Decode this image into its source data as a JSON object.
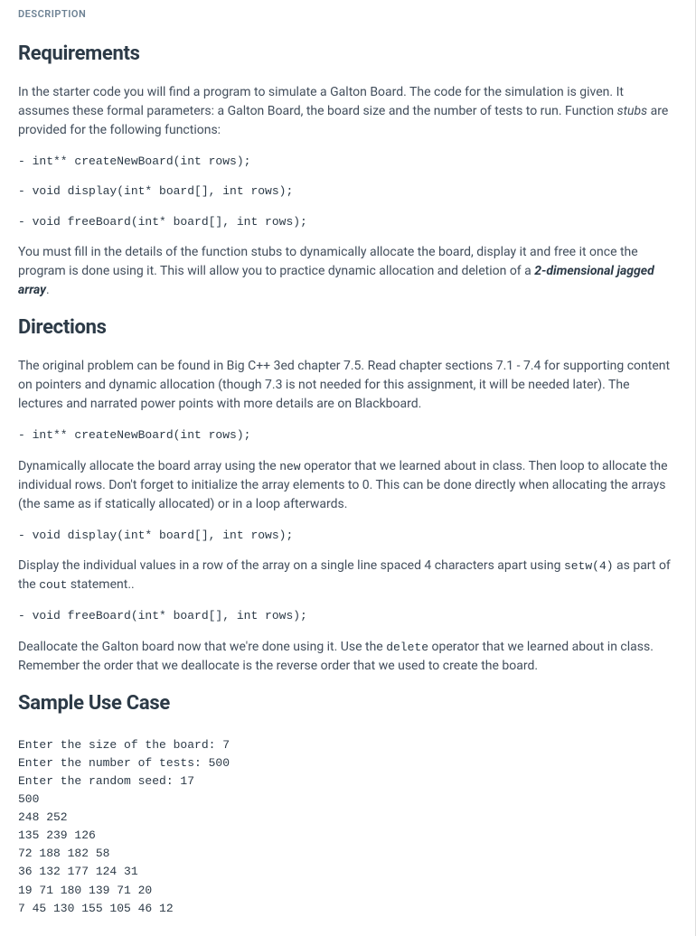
{
  "sectionLabel": "DESCRIPTION",
  "headings": {
    "requirements": "Requirements",
    "directions": "Directions",
    "sample": "Sample Use Case"
  },
  "paragraphs": {
    "req_intro_a": "In the starter code you will find a program to simulate a Galton Board. The code for the simulation is given. It assumes these formal parameters: a Galton Board, the board size and the number of tests to run. Function ",
    "req_intro_stubs": "stubs",
    "req_intro_b": " are provided for the following functions:",
    "req_fill_a": "You must fill in the details of the function stubs to dynamically allocate the board, display it and free it once the program is done using it. This will allow you to practice dynamic allocation and deletion of a ",
    "req_fill_bold": "2-dimensional jagged array",
    "req_fill_b": ".",
    "dir_intro": "The original problem can be found in Big C++ 3ed chapter 7.5. Read chapter sections 7.1 - 7.4 for supporting content on pointers and dynamic allocation (though 7.3 is not needed for this assignment, it will be needed later). The lectures and narrated power points with more details are on Blackboard.",
    "dir_create_a": "Dynamically allocate the board array using the ",
    "dir_create_new": "new",
    "dir_create_b": " operator that we learned about in class. Then loop to allocate the individual rows. Don't forget to initialize the array elements to 0. This can be done directly when allocating the arrays (the same as if statically allocated) or in a loop afterwards.",
    "dir_display_a": "Display the individual values in a row of the array on a single line spaced 4 characters apart using ",
    "dir_display_setw": "setw(4)",
    "dir_display_b": "  as part of the ",
    "dir_display_cout": "cout",
    "dir_display_c": " statement..",
    "dir_free_a": "Deallocate the Galton board now that we're done using it. Use the ",
    "dir_free_delete": "delete",
    "dir_free_b": " operator that we learned about in class. Remember the order that we deallocate is the reverse order that we used to create the board."
  },
  "code": {
    "createNew": "- int** createNewBoard(int rows);",
    "display": "- void display(int* board[], int rows);",
    "freeBoard": "- void freeBoard(int* board[], int rows);"
  },
  "sample_output": "Enter the size of the board: 7\nEnter the number of tests: 500\nEnter the random seed: 17\n500\n248 252\n135 239 126\n72 188 182 58\n36 132 177 124 31\n19 71 180 139 71 20\n7 45 130 155 105 46 12"
}
